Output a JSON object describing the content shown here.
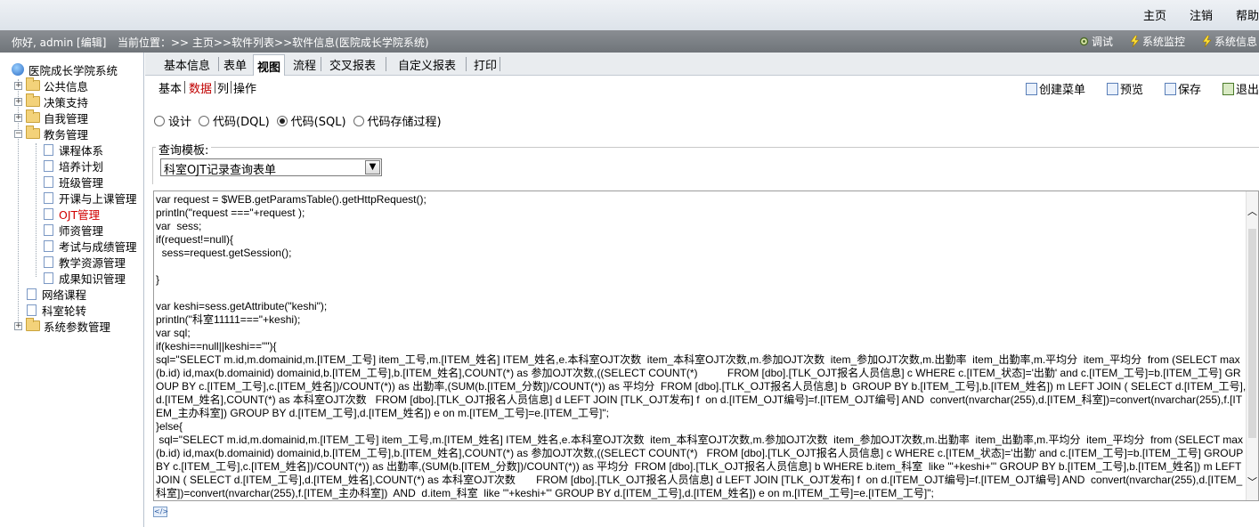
{
  "top_links": [
    "主页",
    "注销",
    "帮助"
  ],
  "status": {
    "greeting": "你好, admin [编辑]",
    "breadcrumb": "当前位置：>> 主页>>软件列表>>软件信息(医院成长学院系统)",
    "tools": [
      {
        "label": "调试",
        "icon": "debug-gear-icon"
      },
      {
        "label": "系统监控",
        "icon": "lightning-icon"
      },
      {
        "label": "系统信息",
        "icon": "lightning-icon"
      }
    ]
  },
  "tree": {
    "root": "医院成长学院系统",
    "groups": [
      {
        "label": "公共信息"
      },
      {
        "label": "决策支持"
      },
      {
        "label": "自我管理"
      },
      {
        "label": "教务管理",
        "children": [
          "课程体系",
          "培养计划",
          "班级管理",
          "开课与上课管理",
          "OJT管理",
          "师资管理",
          "考试与成绩管理",
          "教学资源管理",
          "成果知识管理"
        ]
      },
      {
        "label": "网络课程"
      },
      {
        "label": "科室轮转"
      },
      {
        "label": "系统参数管理"
      }
    ],
    "selected": "OJT管理"
  },
  "tabs": [
    "基本信息",
    "表单",
    "视图",
    "流程",
    "交叉报表",
    "自定义报表",
    "打印"
  ],
  "active_tab": "视图",
  "subtabs": [
    "基本",
    "数据",
    "列",
    "操作"
  ],
  "active_subtab": "数据",
  "actions": [
    {
      "label": "创建菜单",
      "icon": "create-menu-icon"
    },
    {
      "label": "预览",
      "icon": "preview-icon"
    },
    {
      "label": "保存",
      "icon": "save-icon"
    },
    {
      "label": "退出",
      "icon": "exit-icon"
    }
  ],
  "modes": [
    {
      "label": "设计",
      "checked": false
    },
    {
      "label": "代码(DQL)",
      "checked": false
    },
    {
      "label": "代码(SQL)",
      "checked": true
    },
    {
      "label": "代码存储过程)",
      "checked": false
    }
  ],
  "query_template": {
    "legend": "查询模板:",
    "selected": "科室OJT记录查询表单"
  },
  "code": "var request = $WEB.getParamsTable().getHttpRequest();\nprintln(\"request ===\"+request );\nvar  sess;\nif(request!=null){\n  sess=request.getSession();\n\n}\n\nvar keshi=sess.getAttribute(\"keshi\");\nprintln(\"科室11111===\"+keshi);\nvar sql;\nif(keshi==null||keshi==\"\"){\nsql=\"SELECT m.id,m.domainid,m.[ITEM_工号] item_工号,m.[ITEM_姓名] ITEM_姓名,e.本科室OJT次数  item_本科室OJT次数,m.参加OJT次数  item_参加OJT次数,m.出勤率  item_出勤率,m.平均分  item_平均分  from (SELECT max(b.id) id,max(b.domainid) domainid,b.[ITEM_工号],b.[ITEM_姓名],COUNT(*) as 参加OJT次数,((SELECT COUNT(*)          FROM [dbo].[TLK_OJT报名人员信息] c WHERE c.[ITEM_状态]='出勤' and c.[ITEM_工号]=b.[ITEM_工号] GROUP BY c.[ITEM_工号],c.[ITEM_姓名])/COUNT(*)) as 出勤率,(SUM(b.[ITEM_分数])/COUNT(*)) as 平均分  FROM [dbo].[TLK_OJT报名人员信息] b  GROUP BY b.[ITEM_工号],b.[ITEM_姓名]) m LEFT JOIN ( SELECT d.[ITEM_工号],d.[ITEM_姓名],COUNT(*) as 本科室OJT次数   FROM [dbo].[TLK_OJT报名人员信息] d LEFT JOIN [TLK_OJT发布] f  on d.[ITEM_OJT编号]=f.[ITEM_OJT编号] AND  convert(nvarchar(255),d.[ITEM_科室])=convert(nvarchar(255),f.[ITEM_主办科室]) GROUP BY d.[ITEM_工号],d.[ITEM_姓名]) e on m.[ITEM_工号]=e.[ITEM_工号]\";\n}else{\n sql=\"SELECT m.id,m.domainid,m.[ITEM_工号] item_工号,m.[ITEM_姓名] ITEM_姓名,e.本科室OJT次数  item_本科室OJT次数,m.参加OJT次数  item_参加OJT次数,m.出勤率  item_出勤率,m.平均分  item_平均分  from (SELECT max(b.id) id,max(b.domainid) domainid,b.[ITEM_工号],b.[ITEM_姓名],COUNT(*) as 参加OJT次数,((SELECT COUNT(*)   FROM [dbo].[TLK_OJT报名人员信息] c WHERE c.[ITEM_状态]='出勤' and c.[ITEM_工号]=b.[ITEM_工号] GROUP BY c.[ITEM_工号],c.[ITEM_姓名])/COUNT(*)) as 出勤率,(SUM(b.[ITEM_分数])/COUNT(*)) as 平均分  FROM [dbo].[TLK_OJT报名人员信息] b WHERE b.item_科室  like '\"+keshi+\"' GROUP BY b.[ITEM_工号],b.[ITEM_姓名]) m LEFT JOIN ( SELECT d.[ITEM_工号],d.[ITEM_姓名],COUNT(*) as 本科室OJT次数       FROM [dbo].[TLK_OJT报名人员信息] d LEFT JOIN [TLK_OJT发布] f  on d.[ITEM_OJT编号]=f.[ITEM_OJT编号] AND  convert(nvarchar(255),d.[ITEM_科室])=convert(nvarchar(255),f.[ITEM_主办科室])  AND  d.item_科室  like '\"+keshi+\"' GROUP BY d.[ITEM_工号],d.[ITEM_姓名]) e on m.[ITEM_工号]=e.[ITEM_工号]\";"
}
